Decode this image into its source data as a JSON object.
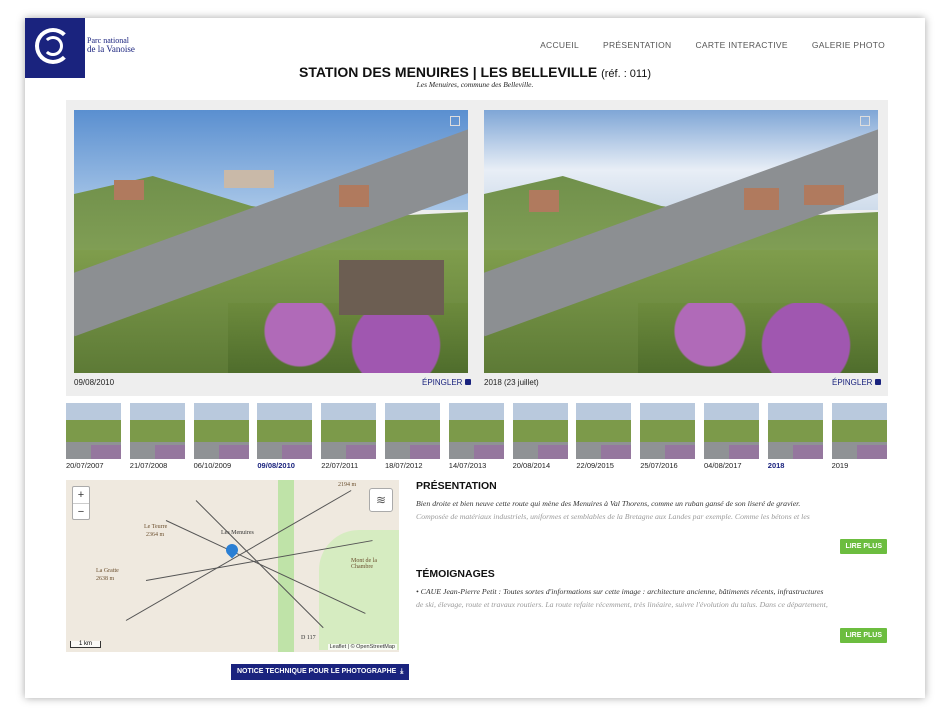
{
  "logo": {
    "line1": "Parc national",
    "line2": "de la Vanoise"
  },
  "nav": [
    "ACCUEIL",
    "PRÉSENTATION",
    "CARTE INTERACTIVE",
    "GALERIE PHOTO"
  ],
  "title": {
    "main": "STATION DES MENUIRES | LES BELLEVILLE",
    "ref": "(réf. : 011)",
    "subtitle": "Les Menuires, commune des Belleville."
  },
  "photos": [
    {
      "date": "09/08/2010",
      "pin": "ÉPINGLER"
    },
    {
      "date": "2018 (23 juillet)",
      "pin": "ÉPINGLER"
    }
  ],
  "thumbnails": [
    {
      "label": "20/07/2007",
      "active": false
    },
    {
      "label": "21/07/2008",
      "active": false
    },
    {
      "label": "06/10/2009",
      "active": false
    },
    {
      "label": "09/08/2010",
      "active": true
    },
    {
      "label": "22/07/2011",
      "active": false
    },
    {
      "label": "18/07/2012",
      "active": false
    },
    {
      "label": "14/07/2013",
      "active": false
    },
    {
      "label": "20/08/2014",
      "active": false
    },
    {
      "label": "22/09/2015",
      "active": false
    },
    {
      "label": "25/07/2016",
      "active": false
    },
    {
      "label": "04/08/2017",
      "active": false
    },
    {
      "label": "2018",
      "active": true
    },
    {
      "label": "2019",
      "active": false
    }
  ],
  "map": {
    "zoom_in": "+",
    "zoom_out": "−",
    "labels": [
      "Le Teurre",
      "2364 m",
      "La Gratte",
      "2638 m",
      "Les Menuires",
      "Mont de la Chambre",
      "D 117",
      "2194 m"
    ],
    "scale": "1 km",
    "attribution": "Leaflet | © OpenStreetMap"
  },
  "notice_button": "NOTICE TECHNIQUE POUR LE PHOTOGRAPHE",
  "presentation": {
    "heading": "PRÉSENTATION",
    "text1": "Bien droite et bien neuve cette route qui mène des Menuires à Val Thorens, comme un ruban gansé de son liseré de gravier.",
    "text2": "Composée de matériaux industriels, uniformes et semblables de la Bretagne aux Landes par exemple. Comme les bétons et les",
    "more": "LIRE PLUS"
  },
  "testimonies": {
    "heading": "TÉMOIGNAGES",
    "text1": "• CAUE Jean-Pierre Petit : Toutes sortes d'informations sur cette image : architecture ancienne, bâtiments récents, infrastructures",
    "text2": "de ski, élevage, route et travaux routiers. La route refaite récemment, très linéaire, suivre l'évolution du talus. Dans ce département,",
    "more": "LIRE PLUS"
  },
  "colors": {
    "brand": "#1a237e",
    "accent_green": "#6cbd3f"
  }
}
